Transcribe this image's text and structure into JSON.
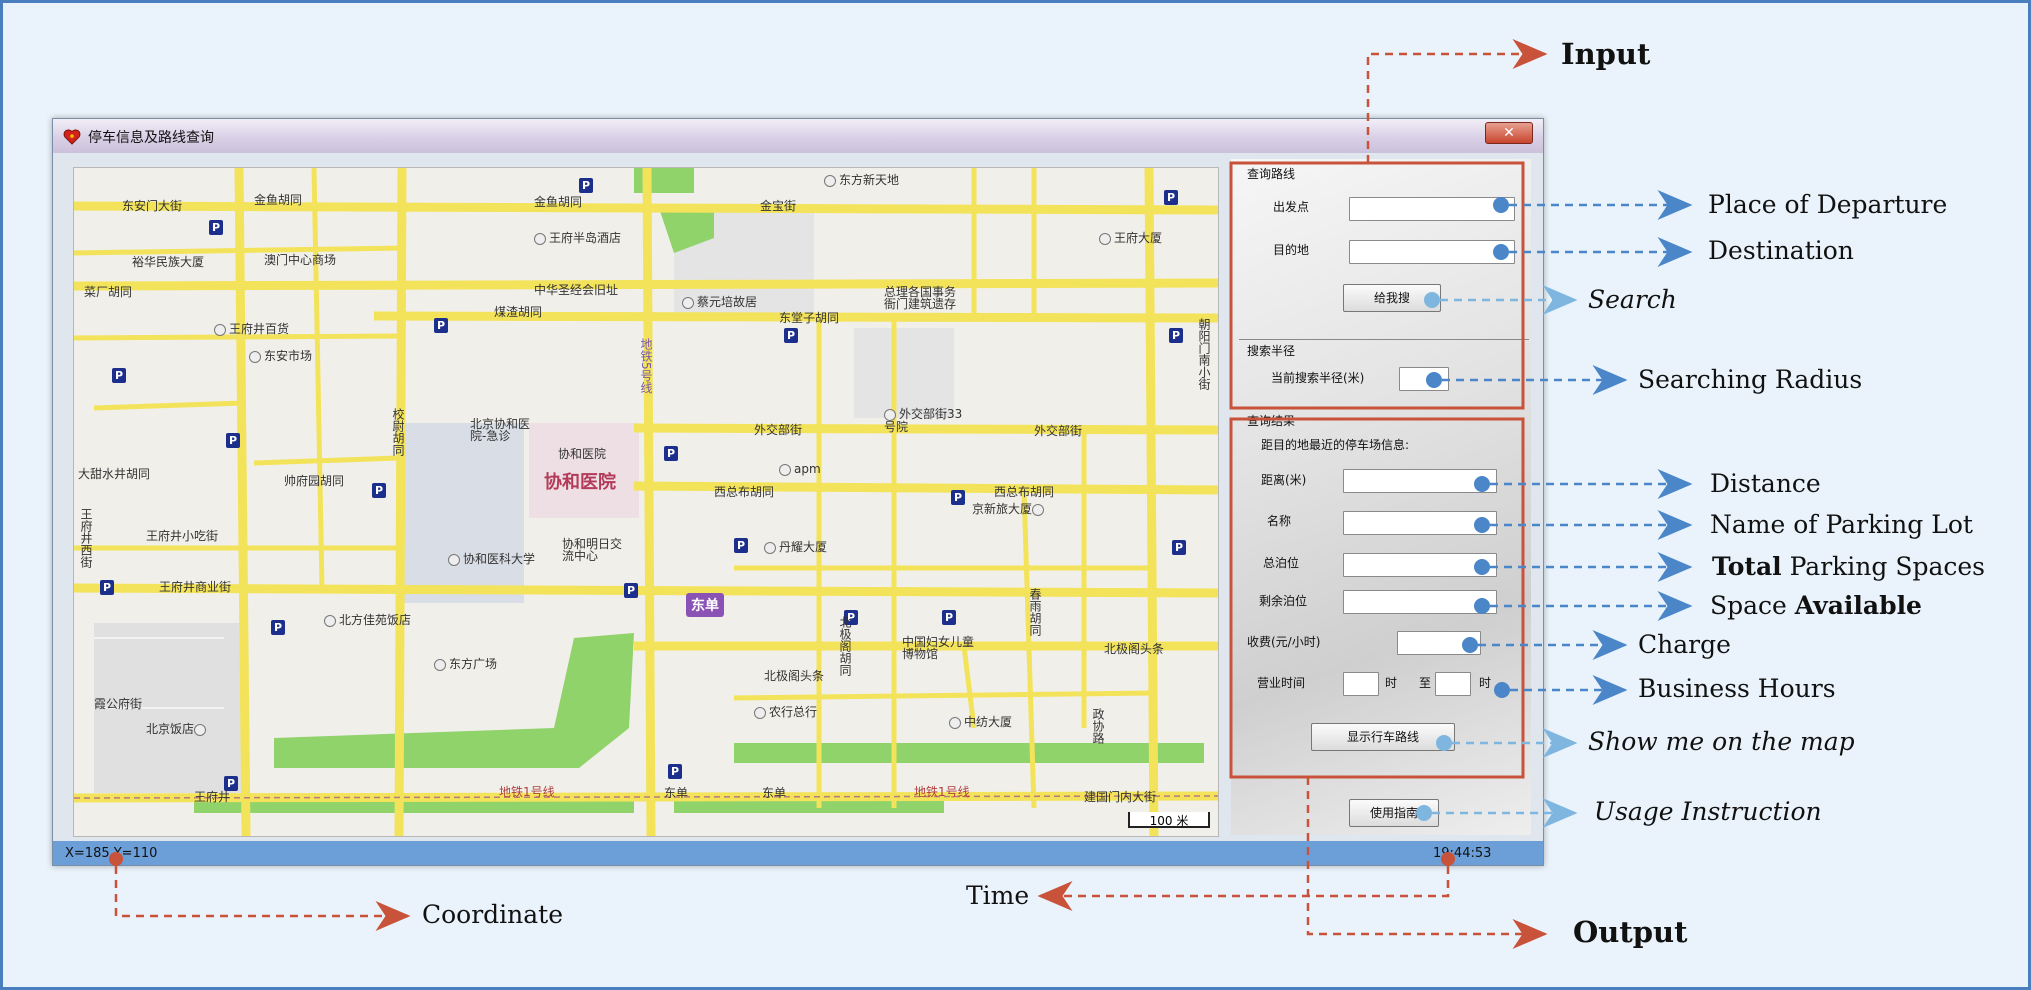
{
  "window": {
    "title": "停车信息及路线查询",
    "close_label": "✕"
  },
  "map": {
    "streets": [
      "东安门大街",
      "金鱼胡同",
      "金鱼胡同",
      "金宝街",
      "东方新天地",
      "王府半岛酒店",
      "王府大厦",
      "裕华民族大厦",
      "澳门中心商场",
      "菜厂胡同",
      "中华圣经会旧址",
      "蔡元培故居",
      "总理各国事务衙门建筑遗存",
      "东堂子胡同",
      "煤渣胡同",
      "王府井百货",
      "东安市场",
      "地铁5号线",
      "朝阳门南小街",
      "校尉胡同",
      "北京协和医院-急诊",
      "协和医院",
      "外交部街",
      "外交部街33号院",
      "外交部街",
      "大甜水井胡同",
      "帅府园胡同",
      "apm",
      "西总布胡同",
      "西总布胡同",
      "京新旅大厦",
      "王府井小吃街",
      "王府井西街",
      "协和医科大学",
      "协和明日交流中心",
      "丹耀大厦",
      "王府井商业街",
      "北方佳苑饭店",
      "北极阁胡同",
      "中国妇女儿童博物馆",
      "春雨胡同",
      "北极阁头条",
      "东方广场",
      "北极阁头条",
      "农行总行",
      "中纺大厦",
      "霞公府街",
      "北京饭店",
      "政协路",
      "王府井",
      "地铁1号线",
      "东单",
      "东单",
      "地铁1号线",
      "建国门内大街"
    ],
    "hospital_label": "协和医院",
    "station_label": "东单",
    "scale_label": "100 米",
    "parking_symbol": "P"
  },
  "panel": {
    "route_group": "查询路线",
    "departure_label": "出发点",
    "destination_label": "目的地",
    "departure_value": "",
    "destination_value": "",
    "search_button": "给我搜",
    "radius_group": "搜索半径",
    "radius_label": "当前搜索半径(米)",
    "radius_value": "",
    "result_group": "查询结果",
    "result_desc": "距目的地最近的停车场信息:",
    "distance_label": "距离(米)",
    "name_label": "名称",
    "total_label": "总泊位",
    "remaining_label": "剩余泊位",
    "charge_label": "收费(元/小时)",
    "hours_label": "营业时间",
    "hour_unit": "时",
    "to_label": "至",
    "hour_unit2": "时",
    "show_route_button": "显示行车路线",
    "guide_button": "使用指南"
  },
  "status": {
    "coordinate": "X=185 Y=110",
    "time": "19:44:53"
  },
  "annotations": {
    "input": "Input",
    "output": "Output",
    "departure": "Place of Departure",
    "destination": "Destination",
    "search": "Search",
    "radius": "Searching Radius",
    "distance": "Distance",
    "name": "Name of Parking Lot",
    "total_bold": "Total",
    "total_rest": " Parking Spaces",
    "space_rest": "Space ",
    "space_bold": "Available",
    "charge": "Charge",
    "hours": "Business Hours",
    "show_map": "Show me on the map",
    "usage": "Usage Instruction",
    "coordinate": "Coordinate",
    "time": "Time"
  },
  "colors": {
    "frame": "#4a7fbf",
    "highlight_box": "#c8533a",
    "blue_arrow": "#4a86c8",
    "light_arrow": "#7fb6e0",
    "red_dot": "#c8533a",
    "road": "#f3e35a",
    "status_bar": "#6c9fd8"
  }
}
